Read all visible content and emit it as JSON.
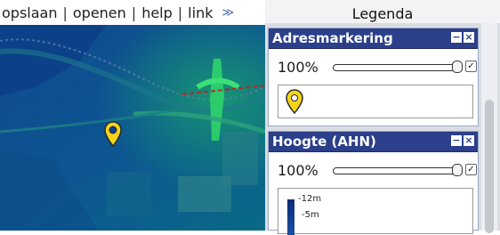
{
  "menu": {
    "items": [
      "opslaan",
      "openen",
      "help",
      "link"
    ],
    "separator": "|",
    "collapse_glyph": "≫"
  },
  "legend": {
    "title": "Legenda",
    "layers": [
      {
        "name": "Adresmarkering",
        "opacity": "100%",
        "visible": true,
        "minimize_glyph": "−",
        "close_glyph": "×",
        "symbol_icon": "map-pin-icon"
      },
      {
        "name": "Hoogte (AHN)",
        "opacity": "100%",
        "visible": true,
        "minimize_glyph": "−",
        "close_glyph": "×",
        "scale_labels": [
          "-12m",
          "-5m"
        ]
      }
    ]
  },
  "colors": {
    "header_blue": "#2b3f8a",
    "map_base": "#0e3f8e",
    "marker_yellow": "#f5d51a"
  }
}
